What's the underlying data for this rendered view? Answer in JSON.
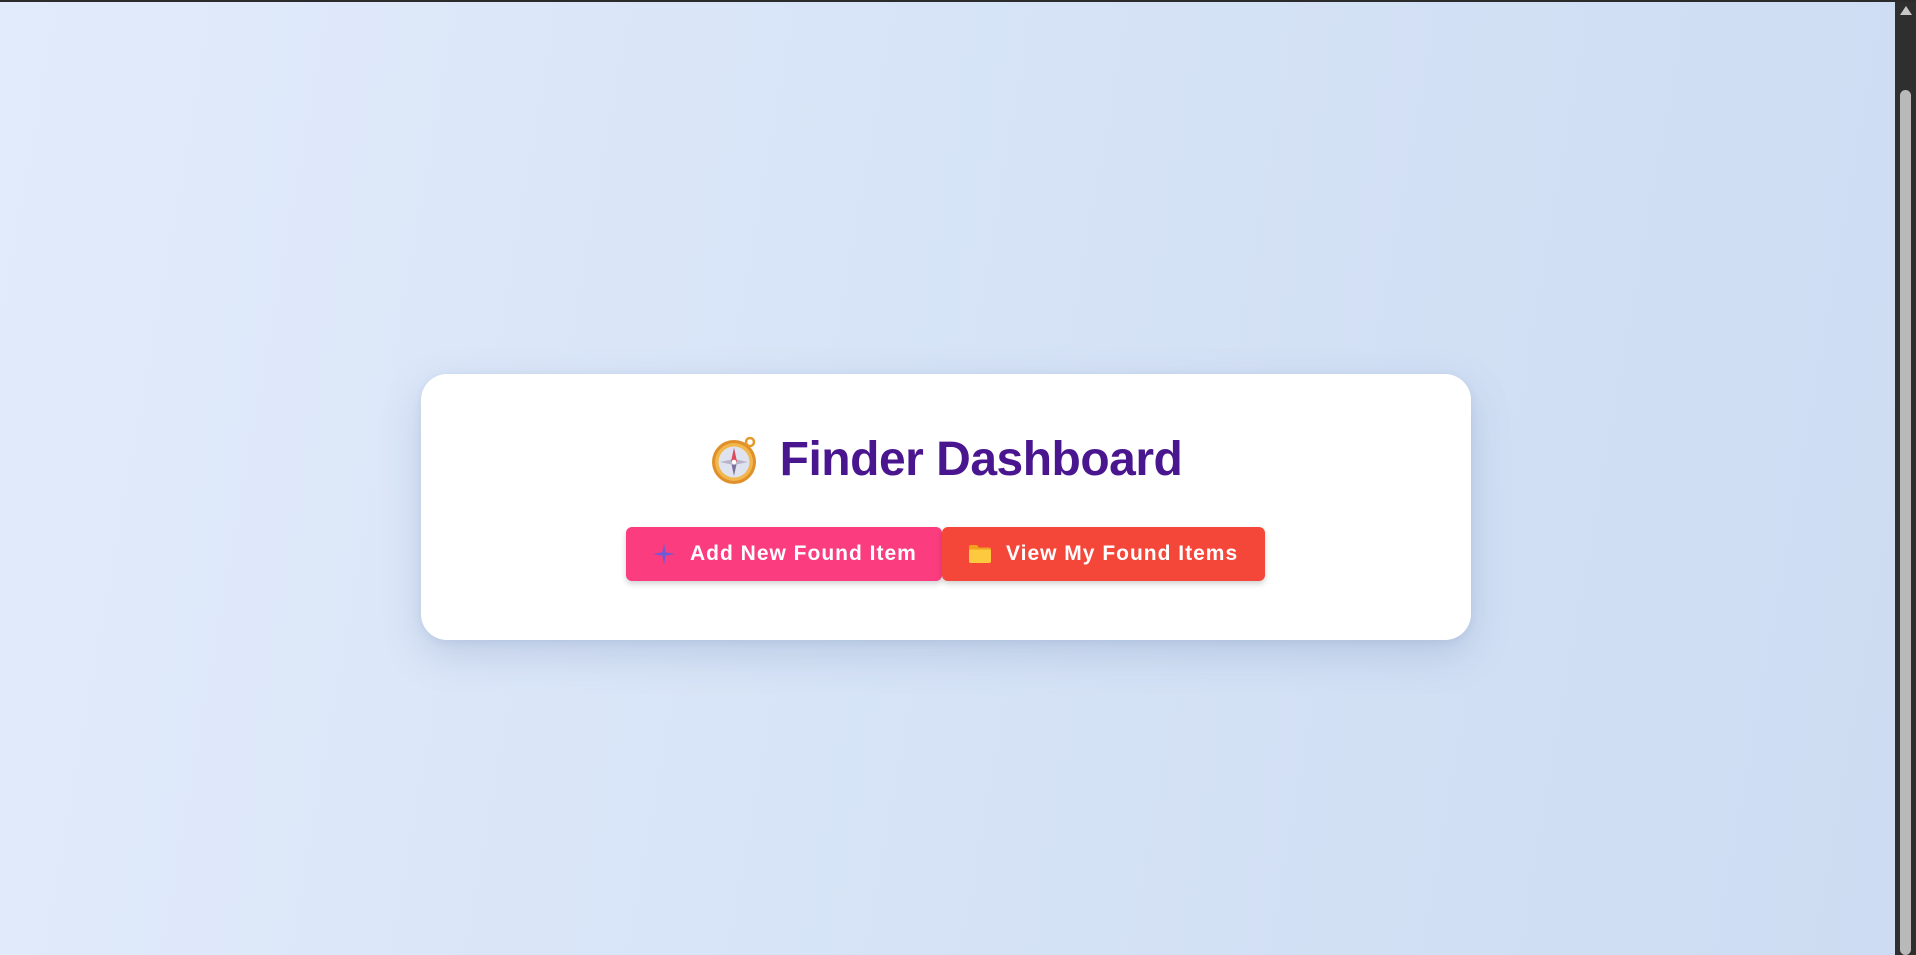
{
  "page": {
    "title": "Finder Dashboard",
    "title_icon": "compass-icon",
    "title_color": "#4a168f"
  },
  "actions": {
    "add_label": "Add New Found Item",
    "add_icon": "sparkle-plus-icon",
    "add_color": "#fb3d7f",
    "view_label": "View My Found Items",
    "view_icon": "folder-icon",
    "view_color": "#f5463a"
  }
}
